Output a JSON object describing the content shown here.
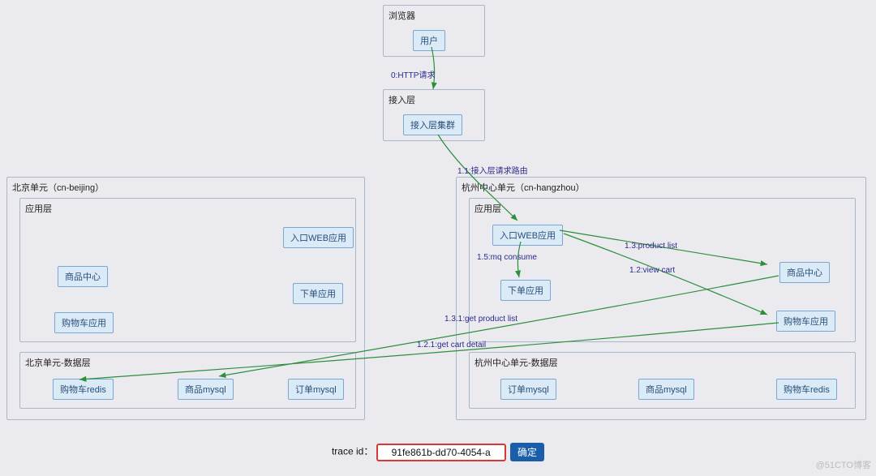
{
  "browser_group": {
    "label": "浏览器"
  },
  "access_group": {
    "label": "接入层"
  },
  "beijing_unit": {
    "label": "北京单元（cn-beijing）"
  },
  "beijing_app": {
    "label": "应用层"
  },
  "beijing_data": {
    "label": "北京单元-数据层"
  },
  "hangzhou_unit": {
    "label": "杭州中心单元（cn-hangzhou）"
  },
  "hangzhou_app": {
    "label": "应用层"
  },
  "hangzhou_data": {
    "label": "杭州中心单元-数据层"
  },
  "nodes": {
    "user": "用户",
    "access_cluster": "接入层集群",
    "bj_web": "入口WEB应用",
    "bj_product_center": "商品中心",
    "bj_cart_app": "购物车应用",
    "bj_order_app": "下单应用",
    "bj_cart_redis": "购物车redis",
    "bj_product_mysql": "商品mysql",
    "bj_order_mysql": "订单mysql",
    "hz_web": "入口WEB应用",
    "hz_order_app": "下单应用",
    "hz_product_center": "商品中心",
    "hz_cart_app": "购物车应用",
    "hz_order_mysql": "订单mysql",
    "hz_product_mysql": "商品mysql",
    "hz_cart_redis": "购物车redis"
  },
  "edges": {
    "e0": "0:HTTP请求",
    "e11": "1.1:接入层请求路由",
    "e12": "1.2:view cart",
    "e13": "1.3:product list",
    "e15": "1.5:mq consume",
    "e121": "1.2.1:get cart detail",
    "e131": "1.3.1:get product list"
  },
  "footer": {
    "label": "trace id：",
    "value": "91fe861b-dd70-4054-a",
    "button": "确定"
  },
  "watermark": "@51CTO博客"
}
